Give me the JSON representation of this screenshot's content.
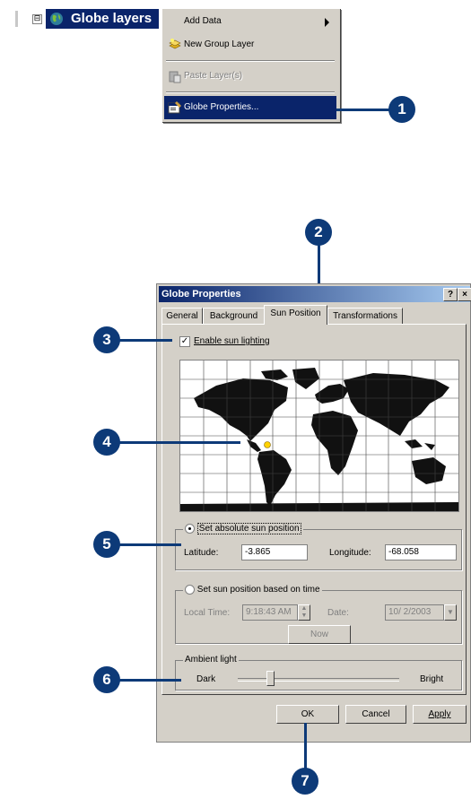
{
  "tree": {
    "expander": "⊟",
    "node_label": "Globe layers"
  },
  "context_menu": {
    "items": [
      {
        "label": "Add Data",
        "has_submenu": true
      },
      {
        "label": "New Group Layer"
      },
      {
        "label": "Paste Layer(s)",
        "disabled": true
      },
      {
        "label": "Globe Properties...",
        "selected": true
      }
    ]
  },
  "callouts": [
    "1",
    "2",
    "3",
    "4",
    "5",
    "6",
    "7"
  ],
  "dialog": {
    "title": "Globe Properties",
    "help_button": "?",
    "close_button": "×",
    "tabs": [
      "General",
      "Background",
      "Sun Position",
      "Transformations"
    ],
    "active_tab": "Sun Position",
    "enable_sun_lighting": {
      "label": "Enable sun lighting",
      "checked": true
    },
    "absolute_group": {
      "label": "Set absolute sun position",
      "latitude_label": "Latitude:",
      "latitude_value": "-3.865",
      "longitude_label": "Longitude:",
      "longitude_value": "-68.058"
    },
    "time_group": {
      "label": "Set sun position based on time",
      "local_time_label": "Local Time:",
      "local_time_value": "9:18:43 AM",
      "date_label": "Date:",
      "date_value": "10/ 2/2003",
      "now_button": "Now"
    },
    "ambient_group": {
      "label": "Ambient light",
      "dark_label": "Dark",
      "bright_label": "Bright",
      "level": 0.2
    },
    "buttons": {
      "ok": "OK",
      "cancel": "Cancel",
      "apply": "Apply"
    }
  },
  "colors": {
    "selection": "#0a246a",
    "callout": "#0d3a78",
    "sun_marker": "#ffd200"
  }
}
